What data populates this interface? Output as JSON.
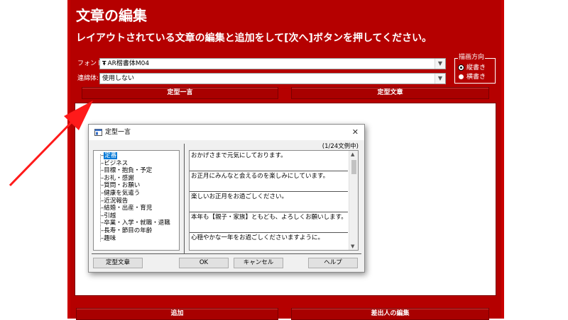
{
  "window": {
    "title": "文章の編集",
    "instruction": "レイアウトされている文章の編集と追加をして[次へ]ボタンを押してください。"
  },
  "font_field": {
    "label": "フォント:",
    "value": "AR楷書体M04",
    "font_type_glyph": "Ŧ"
  },
  "ligature_field": {
    "label": "連綿体:",
    "value": "使用しない"
  },
  "orientation": {
    "legend": "描画方向",
    "options": [
      "縦書き",
      "横書き"
    ],
    "selected": "縦書き"
  },
  "buttons": {
    "teikei_ichigen": "定型一言",
    "teikei_bunsho": "定型文章",
    "add": "追加",
    "sender_edit": "差出人の編集"
  },
  "dialog": {
    "title": "定型一言",
    "count": "(1/24文例中)",
    "categories": [
      "定番",
      "ビジネス",
      "目標・抱負・予定",
      "お礼・感謝",
      "質問・お願い",
      "健康を気遣う",
      "近況報告",
      "結婚・出産・育児",
      "引越",
      "卒業・入学・就職・退職",
      "長寿・節目の年齢",
      "趣味"
    ],
    "selected_category": "定番",
    "phrases": [
      "おかげさまで元気にしております。",
      "お正月にみんなと会えるのを楽しみにしています。",
      "楽しいお正月をお過ごしください。",
      "本年も【親子・家族】ともども、よろしくお願いします。",
      "心穏やかな一年をお過ごしくださいますように。"
    ],
    "buttons": {
      "teikei_bunsho": "定型文章",
      "ok": "OK",
      "cancel": "キャンセル",
      "help": "ヘルプ"
    },
    "close_glyph": "✕"
  },
  "colors": {
    "window_red": "#b50000",
    "annotation_arrow": "#ff1a1a"
  }
}
